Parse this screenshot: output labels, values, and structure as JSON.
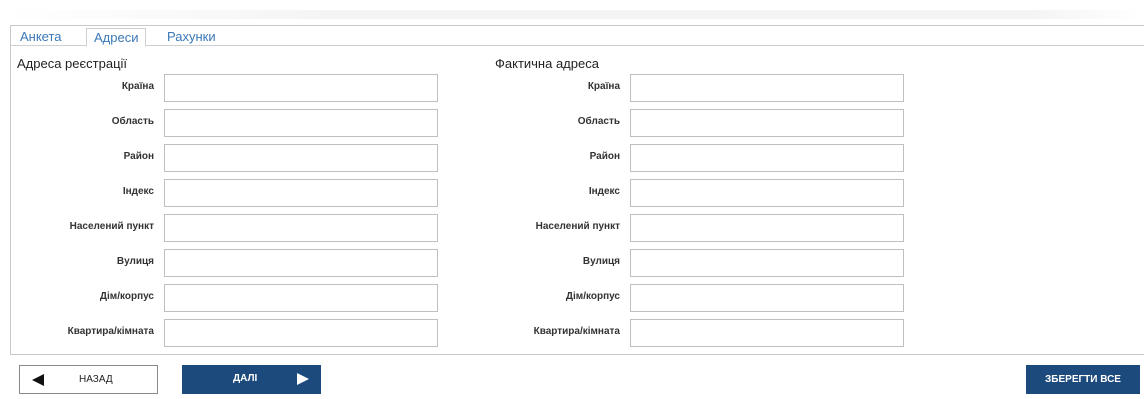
{
  "tabs": [
    {
      "label": "Анкета",
      "active": false
    },
    {
      "label": "Адреси",
      "active": true
    },
    {
      "label": "Рахунки",
      "active": false
    }
  ],
  "registration": {
    "title": "Адреса реєстрації",
    "fields": [
      {
        "label": "Країна",
        "value": ""
      },
      {
        "label": "Область",
        "value": ""
      },
      {
        "label": "Район",
        "value": ""
      },
      {
        "label": "Індекс",
        "value": ""
      },
      {
        "label": "Населений пункт",
        "value": ""
      },
      {
        "label": "Вулиця",
        "value": ""
      },
      {
        "label": "Дім/корпус",
        "value": ""
      },
      {
        "label": "Квартира/кімната",
        "value": ""
      }
    ]
  },
  "actual": {
    "title": "Фактична адреса",
    "fields": [
      {
        "label": "Країна",
        "value": ""
      },
      {
        "label": "Область",
        "value": ""
      },
      {
        "label": "Район",
        "value": ""
      },
      {
        "label": "Індекс",
        "value": ""
      },
      {
        "label": "Населений пункт",
        "value": ""
      },
      {
        "label": "Вулиця",
        "value": ""
      },
      {
        "label": "Дім/корпус",
        "value": ""
      },
      {
        "label": "Квартира/кімната",
        "value": ""
      }
    ]
  },
  "buttons": {
    "back": "НАЗАД",
    "next": "ДАЛІ",
    "save": "ЗБЕРЕГТИ ВСЕ"
  },
  "colors": {
    "primary_button": "#1d4a7c",
    "tab_link": "#3a78b8"
  },
  "icons": {
    "back": "arrow-left-icon",
    "next": "arrow-right-icon"
  }
}
